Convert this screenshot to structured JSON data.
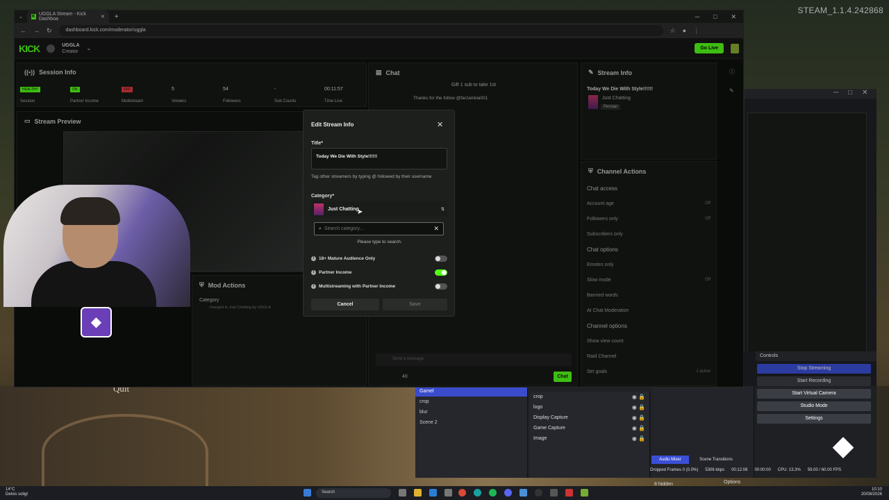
{
  "steam_version": "STEAM_1.1.4.242868",
  "browser": {
    "tab_title": "UGGLA Stream - Kick Dashboa",
    "url": "dashboard.kick.com/moderator/uggla"
  },
  "kick": {
    "logo": "KICK",
    "user_name": "UGGLA",
    "user_role": "Creator",
    "go_live": "Go Live",
    "session": {
      "title": "Session Info",
      "stats": [
        {
          "value": "HEALTHY",
          "label": "Session",
          "color": "#53fc18"
        },
        {
          "value": "ON",
          "label": "Partner Income",
          "color": "#53fc18"
        },
        {
          "value": "OFF",
          "label": "Multistream",
          "color": "#e23b3b"
        },
        {
          "value": "5",
          "label": "Viewers"
        },
        {
          "value": "54",
          "label": "Followers"
        },
        {
          "value": "-",
          "label": "Sub Counts"
        },
        {
          "value": "00:11:57",
          "label": "Time Live"
        }
      ]
    },
    "preview_title": "Stream Preview",
    "mod_actions": {
      "title": "Mod Actions",
      "entry_label": "Category",
      "entry_text": "changed to Just Chatting by UGGLA"
    },
    "chat": {
      "title": "Chat",
      "pinned": "Gift 1 sub to take 1st",
      "message": "Thanks for the follow @farzamkia001",
      "input_placeholder": "Send a message",
      "viewer_count": "40",
      "send": "Chat"
    },
    "stream_info": {
      "title": "Stream Info",
      "stream_title": "Today We Die With Style!!!!!!",
      "category": "Just Chatting",
      "tag": "Persian"
    },
    "channel_actions": {
      "title": "Channel Actions",
      "chat_access": "Chat access",
      "rows1": [
        {
          "label": "Account age",
          "right": "Off"
        },
        {
          "label": "Followers only",
          "right": "Off"
        },
        {
          "label": "Subscribers only",
          "right": ""
        }
      ],
      "chat_options": "Chat options",
      "rows2": [
        {
          "label": "Emotes only",
          "right": ""
        },
        {
          "label": "Slow mode",
          "right": "Off"
        },
        {
          "label": "Banned words",
          "right": ""
        },
        {
          "label": "AI Chat Moderation",
          "right": ""
        }
      ],
      "channel_options": "Channel options",
      "rows3": [
        {
          "label": "Show view count",
          "right": ""
        },
        {
          "label": "Raid Channel",
          "right": ""
        },
        {
          "label": "Set goals",
          "right": "1 active"
        }
      ]
    }
  },
  "modal": {
    "title": "Edit Stream Info",
    "title_label": "Title*",
    "title_value": "Today We Die With Style!!!!!!",
    "tag_hint": "Tag other streamers by typing @ followed by their username",
    "category_label": "Category*",
    "category_value": "Just Chatting",
    "search_placeholder": "Search category...",
    "type_hint": "Please type to search.",
    "options": [
      {
        "label": "18+ Mature Audience Only",
        "on": false
      },
      {
        "label": "Partner Income",
        "on": true
      },
      {
        "label": "Multistreaming with Partner Income",
        "on": false
      }
    ],
    "cancel": "Cancel",
    "save": "Save"
  },
  "game": {
    "quit": "Quit"
  },
  "obs": {
    "scenes": [
      "Gamel",
      "crop",
      "blur",
      "Scene 2"
    ],
    "selected_scene": "Gamel",
    "sources": [
      "crop",
      "logo",
      "Display Capture",
      "Game Capture",
      "Image"
    ],
    "controls_title": "Controls",
    "controls": [
      "Stop Streaming",
      "Start Recording",
      "Start Virtual Camera",
      "Studio Mode",
      "Settings"
    ],
    "mixer_hidden": "8 hidden",
    "mixer_options": "Options",
    "tab_audio": "Audio Mixer",
    "tab_transitions": "Scene Transitions",
    "status": {
      "dropped": "Dropped Frames 0 (0.0%)",
      "kbps": "5306 kbps",
      "stream_time": "00:12:06",
      "rec_time": "00:00:00",
      "cpu": "CPU: 13.3%",
      "fps": "59.00 / 60.00 FPS"
    }
  },
  "taskbar": {
    "weather_temp": "14°C",
    "weather_text": "Delvis soligt",
    "search": "Search",
    "time": "10:10",
    "date": "20/08/2026"
  }
}
